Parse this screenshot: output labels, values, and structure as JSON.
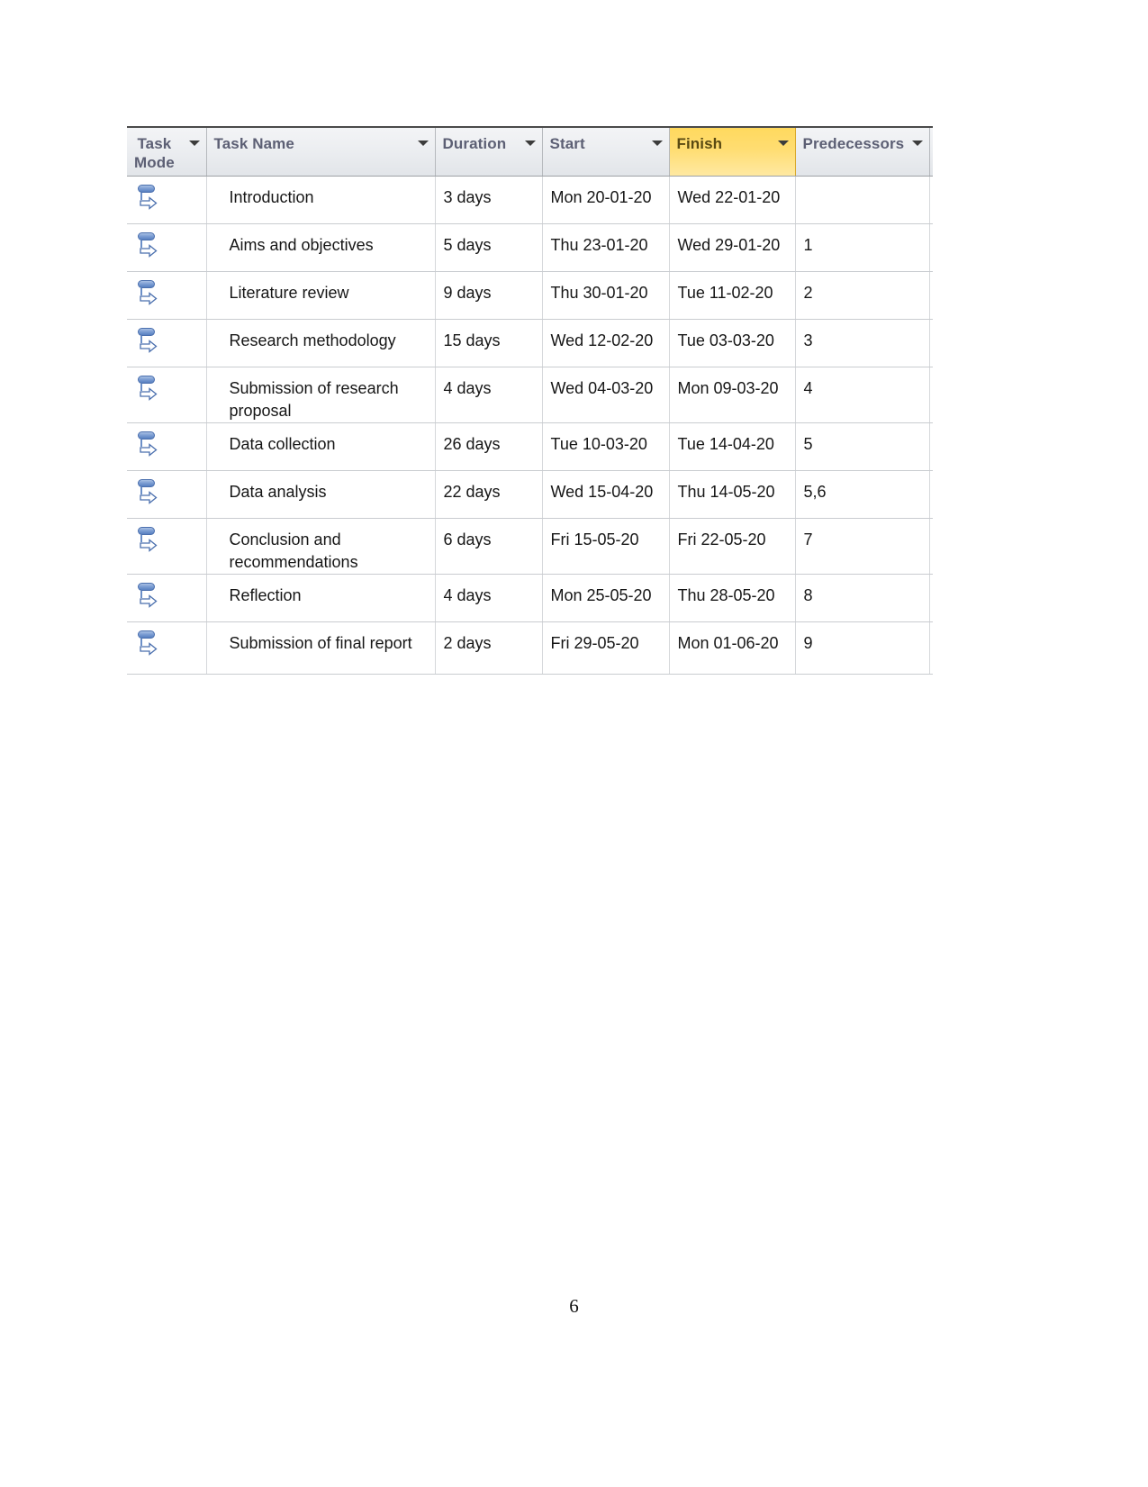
{
  "page": {
    "page_number": "6",
    "background_color": "#ffffff"
  },
  "grid": {
    "name": "project-schedule-grid",
    "highlight_color": "#ffd95e",
    "header_text_color": "#5c5f74",
    "columns": [
      {
        "key": "task_mode",
        "label": "Task\nMode",
        "has_filter": true,
        "highlighted": false
      },
      {
        "key": "task_name",
        "label": "Task Name",
        "has_filter": true,
        "highlighted": false
      },
      {
        "key": "duration",
        "label": "Duration",
        "has_filter": true,
        "highlighted": false
      },
      {
        "key": "start",
        "label": "Start",
        "has_filter": true,
        "highlighted": false
      },
      {
        "key": "finish",
        "label": "Finish",
        "has_filter": true,
        "highlighted": true
      },
      {
        "key": "predecessors",
        "label": "Predecessors",
        "has_filter": true,
        "highlighted": false
      }
    ],
    "rows": [
      {
        "task_mode_icon": "auto-scheduled-icon",
        "task_name": "Introduction",
        "duration": "3 days",
        "start": "Mon 20-01-20",
        "finish": "Wed 22-01-20",
        "predecessors": ""
      },
      {
        "task_mode_icon": "auto-scheduled-icon",
        "task_name": "Aims and objectives",
        "duration": "5 days",
        "start": "Thu 23-01-20",
        "finish": "Wed 29-01-20",
        "predecessors": "1"
      },
      {
        "task_mode_icon": "auto-scheduled-icon",
        "task_name": "Literature review",
        "duration": "9 days",
        "start": "Thu 30-01-20",
        "finish": "Tue 11-02-20",
        "predecessors": "2"
      },
      {
        "task_mode_icon": "auto-scheduled-icon",
        "task_name": "Research methodology",
        "duration": "15 days",
        "start": "Wed 12-02-20",
        "finish": "Tue 03-03-20",
        "predecessors": "3"
      },
      {
        "task_mode_icon": "auto-scheduled-icon",
        "task_name": "Submission of research proposal",
        "duration": "4 days",
        "start": "Wed 04-03-20",
        "finish": "Mon 09-03-20",
        "predecessors": "4"
      },
      {
        "task_mode_icon": "auto-scheduled-icon",
        "task_name": "Data collection",
        "duration": "26 days",
        "start": "Tue 10-03-20",
        "finish": "Tue 14-04-20",
        "predecessors": "5"
      },
      {
        "task_mode_icon": "auto-scheduled-icon",
        "task_name": "Data analysis",
        "duration": "22 days",
        "start": "Wed 15-04-20",
        "finish": "Thu 14-05-20",
        "predecessors": "5,6"
      },
      {
        "task_mode_icon": "auto-scheduled-icon",
        "task_name": "Conclusion and recommendations",
        "duration": "6 days",
        "start": "Fri 15-05-20",
        "finish": "Fri 22-05-20",
        "predecessors": "7"
      },
      {
        "task_mode_icon": "auto-scheduled-icon",
        "task_name": "Reflection",
        "duration": "4 days",
        "start": "Mon 25-05-20",
        "finish": "Thu 28-05-20",
        "predecessors": "8"
      },
      {
        "task_mode_icon": "auto-scheduled-icon",
        "task_name": "Submission of final report",
        "duration": "2 days",
        "start": "Fri 29-05-20",
        "finish": "Mon 01-06-20",
        "predecessors": "9"
      }
    ]
  }
}
